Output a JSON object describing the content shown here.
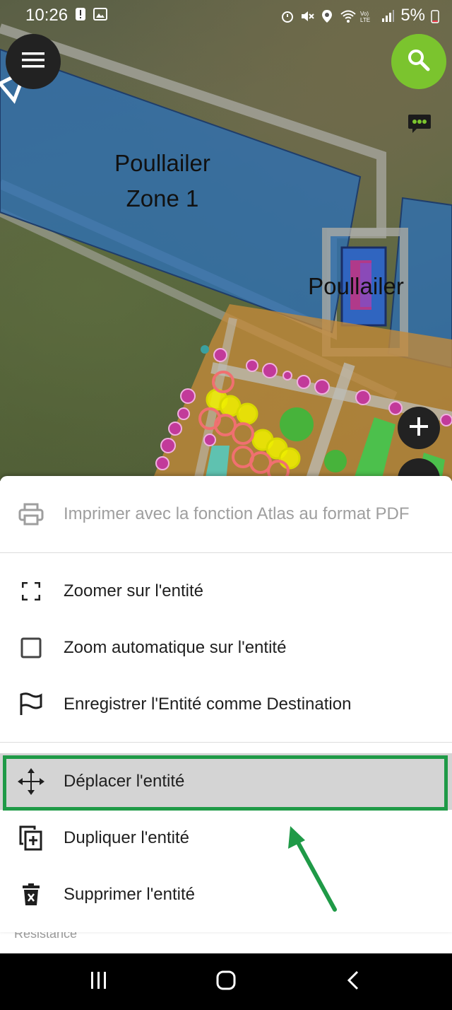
{
  "status_bar": {
    "time": "10:26",
    "battery": "5%",
    "icons": [
      "alert-icon",
      "image-icon",
      "alarm-icon",
      "mute-icon",
      "location-icon",
      "wifi-icon",
      "volte-icon",
      "signal-icon",
      "battery-icon"
    ]
  },
  "map": {
    "labels": {
      "zone1_line1": "Poullailer",
      "zone1_line2": "Zone 1",
      "coop": "Poullailer"
    },
    "buttons": {
      "menu_icon": "menu-icon",
      "search_icon": "search-icon",
      "chat_icon": "chat-icon",
      "plus_icon": "plus-icon"
    },
    "colors": {
      "zone_blue": "#2f6fb0",
      "garden_orange": "#c48a3a",
      "search_green": "#7bc42e"
    }
  },
  "menu": {
    "print": "Imprimer avec la fonction Atlas au format PDF",
    "zoom_to": "Zoomer sur l'entité",
    "auto_zoom": "Zoom automatique sur l'entité",
    "set_destination": "Enregistrer l'Entité comme Destination",
    "move": "Déplacer l'entité",
    "duplicate": "Dupliquer l'entité",
    "delete": "Supprimer l'entité",
    "auto_zoom_checked": false,
    "highlight_color": "#1f9a47"
  },
  "underlay_text": "Resistance",
  "nav_bar": {
    "recents_icon": "recents-icon",
    "home_icon": "home-icon",
    "back_icon": "back-icon"
  }
}
